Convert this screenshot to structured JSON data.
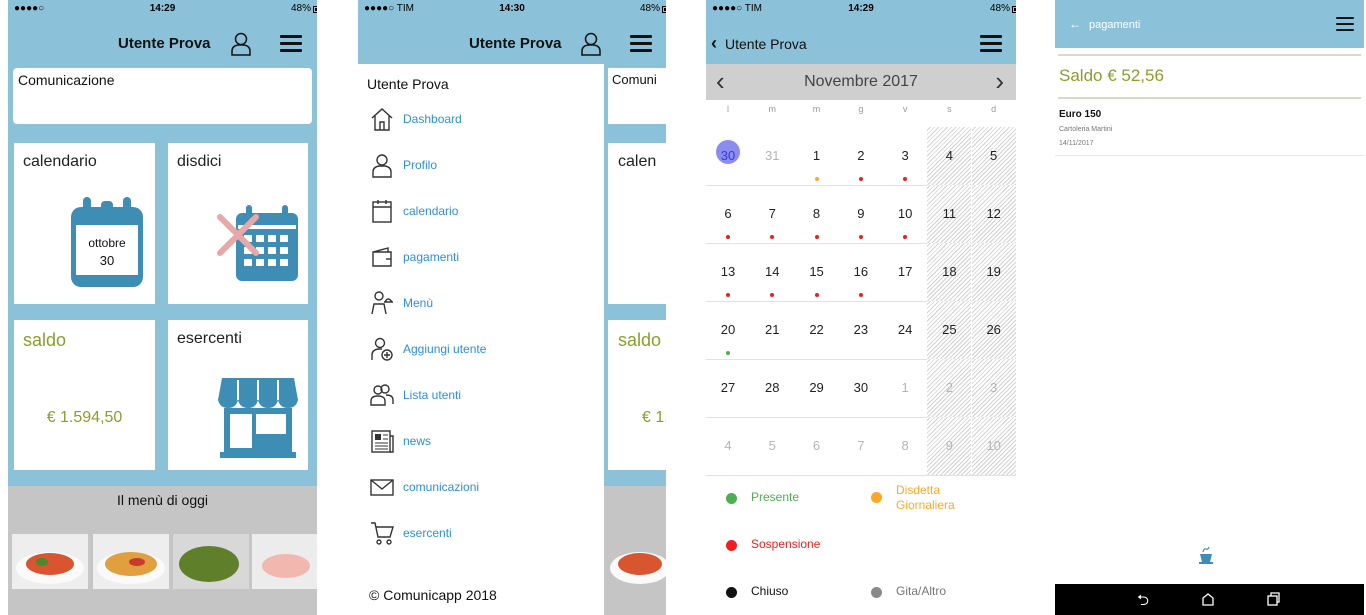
{
  "screen1": {
    "status": {
      "carrier": "●●●●○",
      "time": "14:29",
      "battery": "48%"
    },
    "title": "Utente Prova",
    "communication_label": "Comunicazione",
    "tiles": {
      "calendario": "calendario",
      "calendar_month": "ottobre",
      "calendar_day": "30",
      "disdici": "disdici",
      "saldo": "saldo",
      "saldo_value": "€ 1.594,50",
      "esercenti": "esercenti"
    },
    "menu_today": "Il menù di oggi"
  },
  "screen2": {
    "status": {
      "carrier": "●●●●○ TIM",
      "time": "14:30",
      "battery": "48%"
    },
    "title": "Utente Prova",
    "drawer_title": "Utente Prova",
    "items": [
      {
        "label": "Dashboard",
        "icon": "home-icon"
      },
      {
        "label": "Profilo",
        "icon": "user-icon"
      },
      {
        "label": "calendario",
        "icon": "calendar-icon"
      },
      {
        "label": "pagamenti",
        "icon": "wallet-icon"
      },
      {
        "label": "Menù",
        "icon": "waiter-icon"
      },
      {
        "label": "Aggiungi utente",
        "icon": "add-user-icon"
      },
      {
        "label": "Lista utenti",
        "icon": "users-icon"
      },
      {
        "label": "news",
        "icon": "newspaper-icon"
      },
      {
        "label": "comunicazioni",
        "icon": "envelope-icon"
      },
      {
        "label": "esercenti",
        "icon": "cart-icon"
      }
    ],
    "footer": "© Comunicapp 2018",
    "behind": {
      "comm": "Comuni",
      "cal": "calen",
      "saldo": "saldo",
      "value": "€ 1."
    }
  },
  "screen3": {
    "status": {
      "carrier": "●●●●○ TIM",
      "time": "14:29",
      "battery": "48%"
    },
    "back_title": "Utente Prova",
    "month": "Novembre 2017",
    "weekdays": [
      "l",
      "m",
      "m",
      "g",
      "v",
      "s",
      "d"
    ],
    "days": [
      [
        "30",
        "31",
        "1",
        "2",
        "3",
        "4",
        "5"
      ],
      [
        "6",
        "7",
        "8",
        "9",
        "10",
        "11",
        "12"
      ],
      [
        "13",
        "14",
        "15",
        "16",
        "17",
        "18",
        "19"
      ],
      [
        "20",
        "21",
        "22",
        "23",
        "24",
        "25",
        "26"
      ],
      [
        "27",
        "28",
        "29",
        "30",
        "1",
        "2",
        "3"
      ],
      [
        "4",
        "5",
        "6",
        "7",
        "8",
        "9",
        "10"
      ]
    ],
    "legend": {
      "presente": "Presente",
      "disdetta": "Disdetta Giornaliera",
      "sospensione": "Sospensione",
      "chiuso": "Chiuso",
      "gita": "Gita/Altro"
    },
    "colors": {
      "presente": "#4caf50",
      "disdetta": "#ffa726",
      "sospensione": "#f01e1e",
      "chiuso": "#111111",
      "gita": "#8a8a8a",
      "today": "#8c8cf0"
    }
  },
  "screen4": {
    "title": "pagamenti",
    "saldo": "Saldo € 52,56",
    "entry": {
      "amount": "Euro 150",
      "merchant": "Cartoleria Martini",
      "date": "14/11/2017"
    }
  }
}
